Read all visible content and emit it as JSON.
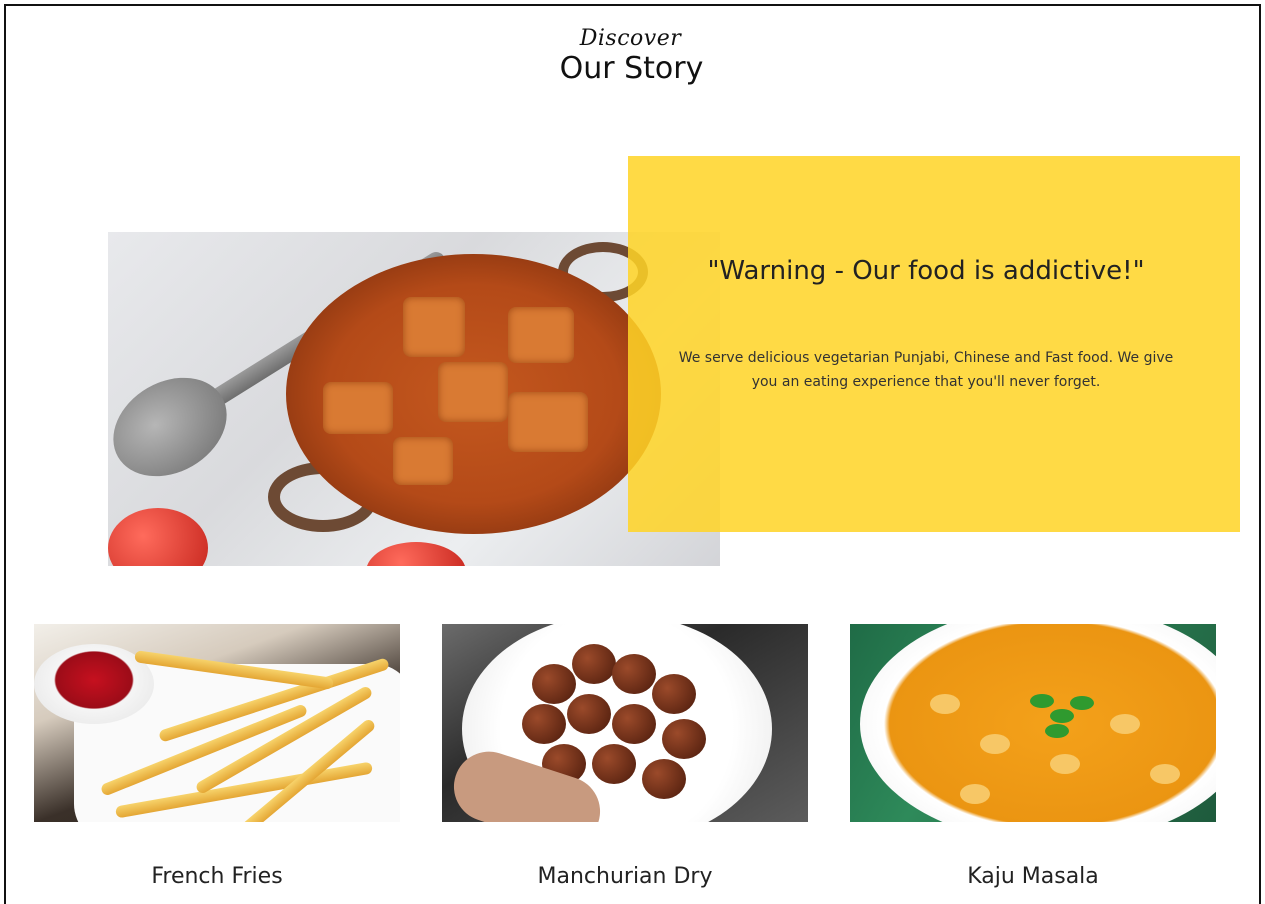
{
  "header": {
    "subtitle": "Discover",
    "title": "Our Story"
  },
  "story": {
    "quote_title": "\"Warning - Our food is addictive!\"",
    "quote_body": "We serve delicious vegetarian Punjabi, Chinese and Fast food. We give you an eating experience that you'll never forget.",
    "accent_color": "#FFD426"
  },
  "menu_items": [
    {
      "label": "French Fries"
    },
    {
      "label": "Manchurian Dry"
    },
    {
      "label": "Kaju Masala"
    }
  ]
}
